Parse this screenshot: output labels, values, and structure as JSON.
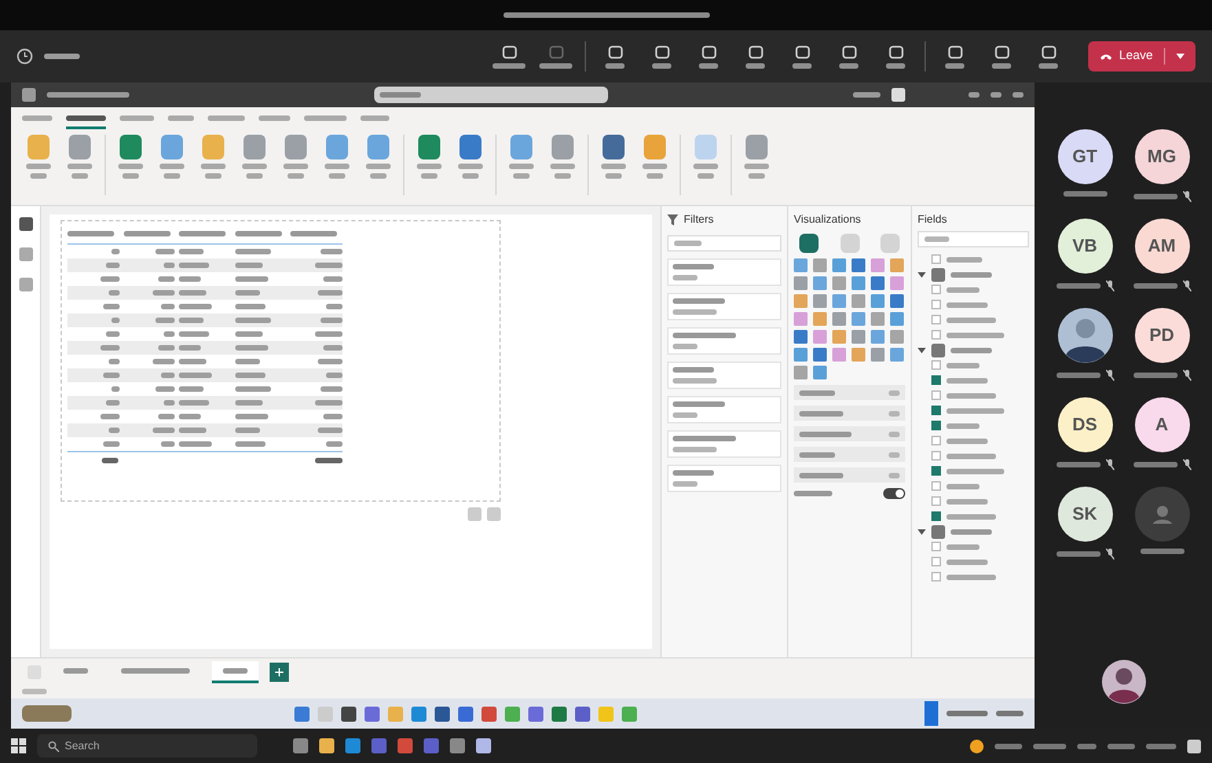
{
  "meeting": {
    "leave_label": "Leave"
  },
  "report": {
    "ribbon_tabs": [
      {
        "selected": false
      },
      {
        "selected": true
      },
      {
        "selected": false
      },
      {
        "selected": false
      },
      {
        "selected": false
      },
      {
        "selected": false
      },
      {
        "selected": false
      },
      {
        "selected": false
      }
    ],
    "filters_title": "Filters",
    "visualizations_title": "Visualizations",
    "visual_types": [
      {
        "selected": true
      },
      {
        "selected": false
      },
      {
        "selected": false
      }
    ],
    "fields_title": "Fields",
    "fields": [
      {
        "checked": false
      },
      {
        "expanded": true,
        "children": [
          {
            "checked": false
          },
          {
            "checked": false
          },
          {
            "checked": false
          },
          {
            "checked": false
          }
        ]
      },
      {
        "expanded": true,
        "children": [
          {
            "checked": false
          },
          {
            "checked": true
          },
          {
            "checked": false
          },
          {
            "checked": true
          },
          {
            "checked": true
          },
          {
            "checked": false
          },
          {
            "checked": false
          },
          {
            "checked": true
          },
          {
            "checked": false
          },
          {
            "checked": false
          },
          {
            "checked": true
          }
        ]
      },
      {
        "expanded": true,
        "children": [
          {
            "checked": false
          },
          {
            "checked": false
          },
          {
            "checked": false
          }
        ]
      }
    ],
    "page_tabs": [
      {
        "selected": false
      },
      {
        "selected": false
      },
      {
        "selected": true
      }
    ],
    "toggle": {
      "on": true
    }
  },
  "participants": [
    {
      "kind": "initials",
      "initials": "GT",
      "color": "#d9daf5",
      "muted": false
    },
    {
      "kind": "initials",
      "initials": "MG",
      "color": "#f5d5d8",
      "muted": true
    },
    {
      "kind": "initials",
      "initials": "VB",
      "color": "#e2f0d9",
      "muted": true
    },
    {
      "kind": "initials",
      "initials": "AM",
      "color": "#fbd9d3",
      "muted": true
    },
    {
      "kind": "photo",
      "muted": true
    },
    {
      "kind": "initials",
      "initials": "PD",
      "color": "#fbdcd9",
      "muted": true
    },
    {
      "kind": "initials",
      "initials": "DS",
      "color": "#fbf0c8",
      "muted": true
    },
    {
      "kind": "initials",
      "initials": "A",
      "color": "#f9d9ec",
      "muted": true
    },
    {
      "kind": "initials",
      "initials": "SK",
      "color": "#dfe8dc",
      "muted": true
    },
    {
      "kind": "anonymous",
      "muted": false
    }
  ],
  "taskbar": {
    "search_label": "Search"
  }
}
